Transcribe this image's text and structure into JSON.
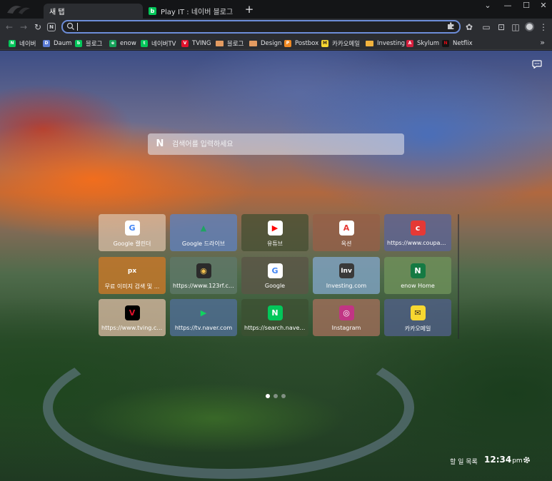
{
  "tabs": [
    {
      "title": "새 탭",
      "active": true
    },
    {
      "title": "Play IT : 네이버 블로그",
      "active": false
    }
  ],
  "omnibox": {
    "value": "",
    "placeholder": ""
  },
  "bookmarks": [
    {
      "label": "네이버",
      "icon": "naver",
      "color": "#03c75a",
      "glyph": "N"
    },
    {
      "label": "Daum",
      "icon": "daum",
      "color": "#5b7bd5",
      "glyph": "D"
    },
    {
      "label": "블로그",
      "icon": "naver-blog",
      "color": "#03c75a",
      "glyph": "b"
    },
    {
      "label": "enow",
      "icon": "enow",
      "color": "#16a35a",
      "glyph": "e"
    },
    {
      "label": "네이버TV",
      "icon": "naver-tv",
      "color": "#03c75a",
      "glyph": "t"
    },
    {
      "label": "TVING",
      "icon": "tving",
      "color": "#e1112c",
      "glyph": "V"
    },
    {
      "label": "블로그",
      "icon": "folder",
      "color": "#e39b61"
    },
    {
      "label": "Design",
      "icon": "folder",
      "color": "#e39b61"
    },
    {
      "label": "Postbox",
      "icon": "postbox",
      "color": "#f08a24",
      "glyph": "P"
    },
    {
      "label": "카카오메일",
      "icon": "kakao-mail",
      "color": "#f7d731",
      "glyph": "M"
    },
    {
      "label": "Investing",
      "icon": "folder",
      "color": "#f2b33d"
    },
    {
      "label": "Skylum",
      "icon": "skylum",
      "color": "#d6203e",
      "glyph": "A"
    },
    {
      "label": "Netflix",
      "icon": "netflix",
      "color": "#141414",
      "glyph": "N"
    }
  ],
  "search": {
    "placeholder": "검색어를 입력하세요"
  },
  "tiles": [
    {
      "label": "Google 캘린더",
      "icon": "google-g",
      "bg": "rgba(222,196,170,0.72)",
      "icon_bg": "#ffffff",
      "glyph": "G",
      "glyph_color": "#4285f4"
    },
    {
      "label": "Google 드라이브",
      "icon": "google-drive",
      "bg": "rgba(95,130,190,0.78)",
      "icon_bg": "transparent",
      "glyph": "▲",
      "glyph_color": "#1fa463"
    },
    {
      "label": "유튜브",
      "icon": "youtube",
      "bg": "rgba(70,80,50,0.78)",
      "icon_bg": "#ffffff",
      "glyph": "▶",
      "glyph_color": "#ff0000"
    },
    {
      "label": "옥션",
      "icon": "auction",
      "bg": "rgba(150,95,70,0.78)",
      "icon_bg": "#ffffff",
      "glyph": "A",
      "glyph_color": "#e53935"
    },
    {
      "label": "https://www.coupang...",
      "icon": "coupang",
      "bg": "rgba(90,100,150,0.78)",
      "icon_bg": "#e53935",
      "glyph": "c",
      "glyph_color": "#ffffff"
    },
    {
      "label": "무료 이미지 검색 및 ...",
      "icon": "pixabay",
      "bg": "rgba(200,120,40,0.82)",
      "icon_bg": "transparent",
      "glyph": "px",
      "glyph_color": "#ffffff"
    },
    {
      "label": "https://www.123rf.co...",
      "icon": "123rf",
      "bg": "rgba(95,120,105,0.78)",
      "icon_bg": "#2b2b2b",
      "glyph": "◉",
      "glyph_color": "#f2c14e"
    },
    {
      "label": "Google",
      "icon": "google-g",
      "bg": "rgba(90,85,70,0.8)",
      "icon_bg": "#ffffff",
      "glyph": "G",
      "glyph_color": "#4285f4"
    },
    {
      "label": "Investing.com",
      "icon": "investing",
      "bg": "rgba(130,165,200,0.78)",
      "icon_bg": "#3a3a3a",
      "glyph": "Inv",
      "glyph_color": "#ffffff"
    },
    {
      "label": "enow Home",
      "icon": "enow",
      "bg": "rgba(110,145,90,0.8)",
      "icon_bg": "#157a43",
      "glyph": "N",
      "glyph_color": "#ffffff"
    },
    {
      "label": "https://www.tving.com",
      "icon": "tving",
      "bg": "rgba(215,185,160,0.78)",
      "icon_bg": "#000000",
      "glyph": "V",
      "glyph_color": "#e1112c"
    },
    {
      "label": "https://tv.naver.com",
      "icon": "naver-tv",
      "bg": "rgba(80,110,150,0.8)",
      "icon_bg": "transparent",
      "glyph": "▶",
      "glyph_color": "#11d35f"
    },
    {
      "label": "https://search.naver.c...",
      "icon": "naver",
      "bg": "rgba(60,80,50,0.8)",
      "icon_bg": "#03c75a",
      "glyph": "N",
      "glyph_color": "#ffffff"
    },
    {
      "label": "Instagram",
      "icon": "instagram",
      "bg": "rgba(160,110,90,0.8)",
      "icon_bg": "#c13584",
      "glyph": "◎",
      "glyph_color": "#ffffff"
    },
    {
      "label": "카카오메일",
      "icon": "kakao-mail",
      "bg": "rgba(80,95,135,0.8)",
      "icon_bg": "#f7d731",
      "glyph": "✉",
      "glyph_color": "#3a2b1a"
    }
  ],
  "pager": {
    "count": 3,
    "active": 0
  },
  "footer": {
    "todo": "할 일 목록",
    "time": "12:34",
    "ampm": "pm"
  },
  "colors": {
    "accent": "#6d8dd8",
    "chrome_bg": "#2b2d31",
    "tabstrip_bg": "#141517"
  }
}
